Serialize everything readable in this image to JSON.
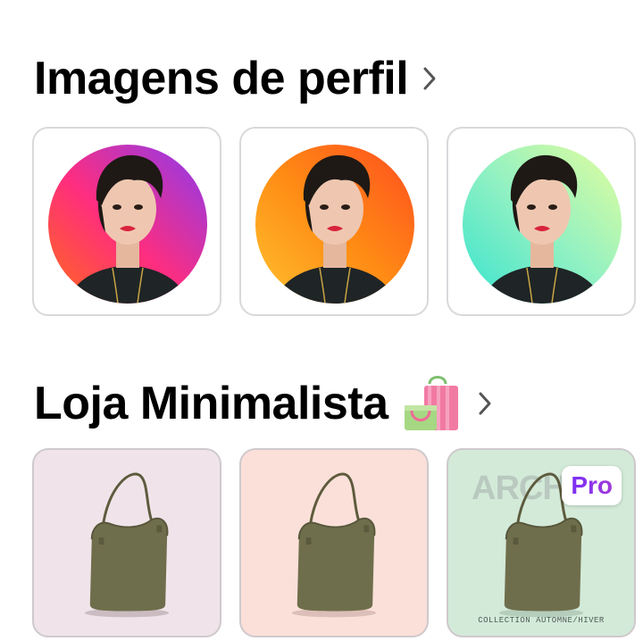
{
  "sections": [
    {
      "title": "Imagens de perfil",
      "chevron_icon": "chevron-right-icon",
      "items": [
        {
          "name": "gradient-pink-purple",
          "colors": [
            "#ff2d7e",
            "#ff6a1a",
            "#8a3bf0"
          ]
        },
        {
          "name": "gradient-orange",
          "colors": [
            "#ffb52b",
            "#ff7b14",
            "#ff4f1f"
          ]
        },
        {
          "name": "gradient-mint",
          "colors": [
            "#3fe6c9",
            "#8af0c0",
            "#dffc9c"
          ]
        }
      ]
    },
    {
      "title": "Loja Minimalista",
      "title_icon": "shopping-bags-icon",
      "chevron_icon": "chevron-right-icon",
      "items": [
        {
          "background": "#f0e4ea"
        },
        {
          "background": "#fbe0d9"
        },
        {
          "background": "#d3ead9",
          "badge": "Pro",
          "watermark": "ARCHIV",
          "caption": "COLLECTION AUTOMNE/HIVER"
        }
      ]
    }
  ],
  "colors": {
    "title": "#000000",
    "card_border": "#d9d9dc",
    "pro_gradient": [
      "#7b2ff7",
      "#a03ad8"
    ],
    "bag_color": "#6f6e4c"
  }
}
